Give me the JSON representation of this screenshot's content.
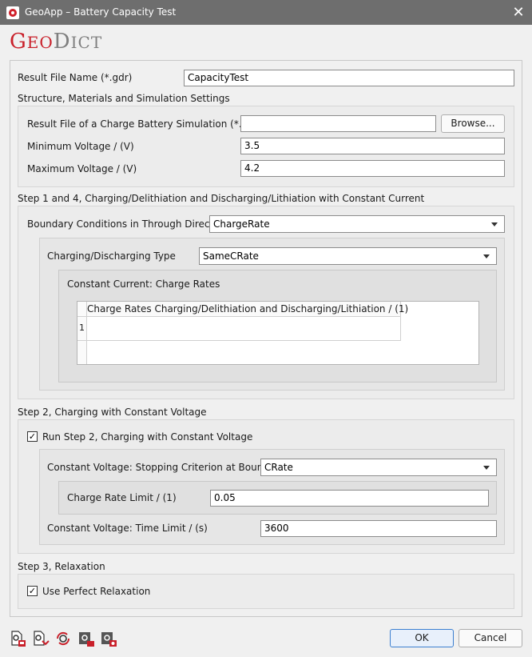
{
  "window": {
    "title": "GeoApp – Battery Capacity Test",
    "close_glyph": "✕"
  },
  "logo": {
    "g": "G",
    "eo": "EO",
    "d": "D",
    "ict": "ICT"
  },
  "result_file": {
    "label": "Result File Name (*.gdr)",
    "value": "CapacityTest"
  },
  "structure_section": {
    "title": "Structure, Materials and Simulation Settings",
    "charge_file_label": "Result File of a Charge Battery Simulation (*.gdr)",
    "charge_file_value": "",
    "browse_label": "Browse...",
    "min_voltage_label": "Minimum Voltage / (V)",
    "min_voltage_value": "3.5",
    "max_voltage_label": "Maximum Voltage / (V)",
    "max_voltage_value": "4.2"
  },
  "step14": {
    "title": "Step 1 and 4, Charging/Delithiation and Discharging/Lithiation with Constant Current",
    "boundary_label": "Boundary Conditions in Through Direction",
    "boundary_value": "ChargeRate",
    "type_label": "Charging/Discharging Type",
    "type_value": "SameCRate",
    "charge_rates_title": "Constant Current: Charge Rates",
    "table_header": "Charge Rates Charging/Delithiation and Discharging/Lithiation / (1)",
    "rows": [
      {
        "index": "1",
        "value": ""
      }
    ]
  },
  "step2": {
    "title": "Step 2, Charging with Constant Voltage",
    "run_checked": true,
    "run_label": "Run Step 2, Charging with Constant Voltage",
    "stop_label": "Constant Voltage: Stopping Criterion at Boundary",
    "stop_value": "CRate",
    "rate_limit_label": "Charge Rate Limit / (1)",
    "rate_limit_value": "0.05",
    "time_limit_label": "Constant Voltage: Time Limit / (s)",
    "time_limit_value": "3600"
  },
  "step3": {
    "title": "Step 3, Relaxation",
    "perfect_checked": true,
    "perfect_label": "Use Perfect Relaxation"
  },
  "check_glyph": "✓",
  "footer": {
    "icons": [
      "load-settings-icon",
      "save-settings-icon",
      "reset-settings-icon",
      "run-macro-icon",
      "record-macro-icon"
    ],
    "ok_label": "OK",
    "cancel_label": "Cancel"
  },
  "colors": {
    "brand": "#c9202a",
    "titlebar": "#6e6e6e"
  }
}
